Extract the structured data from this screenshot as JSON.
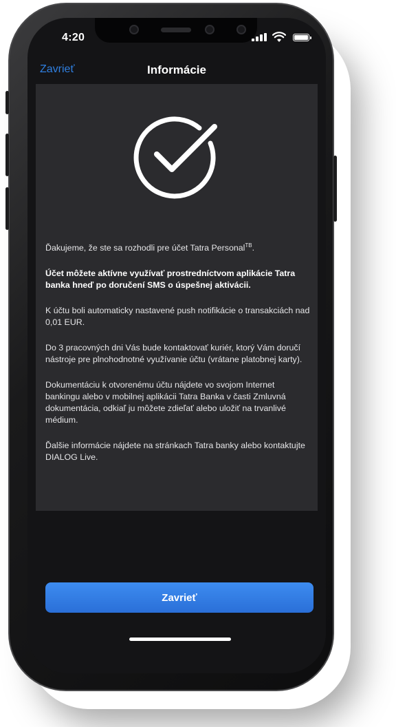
{
  "status_bar": {
    "time": "4:20"
  },
  "nav": {
    "close_label": "Zavrieť",
    "title": "Informácie"
  },
  "content": {
    "para1": "Ďakujeme, že ste sa rozhodli pre účet Tatra Personal",
    "para1_sup": "TB",
    "para1_end": ".",
    "para2": "Účet môžete aktívne využívať prostredníctvom aplikácie Tatra banka hneď po doručení SMS o úspešnej aktivácii.",
    "para3": "K účtu boli automaticky nastavené push notifikácie o transakciách nad 0,01 EUR.",
    "para4": "Do 3 pracovných dni Vás bude kontaktovať kuriér, ktorý Vám doručí nástroje pre plnohodnotné využívanie účtu (vrátane platobnej karty).",
    "para5": "Dokumentáciu k otvorenému účtu nájdete vo svojom Internet bankingu alebo v mobilnej aplikácii Tatra Banka v časti Zmluvná dokumentácia, odkiaľ ju môžete zdieľať alebo uložiť na trvanlivé médium.",
    "para6": "Ďalšie informácie nájdete na stránkach Tatra banky alebo kontaktujte DIALOG Live."
  },
  "footer": {
    "button_label": "Zavrieť"
  },
  "colors": {
    "accent": "#2f7fe0",
    "button": "#3d8cf0",
    "background": "#141416",
    "card": "#2b2b2e"
  },
  "icons": {
    "success": "check-circle-icon",
    "signal": "signal-icon",
    "wifi": "wifi-icon",
    "battery": "battery-icon"
  }
}
